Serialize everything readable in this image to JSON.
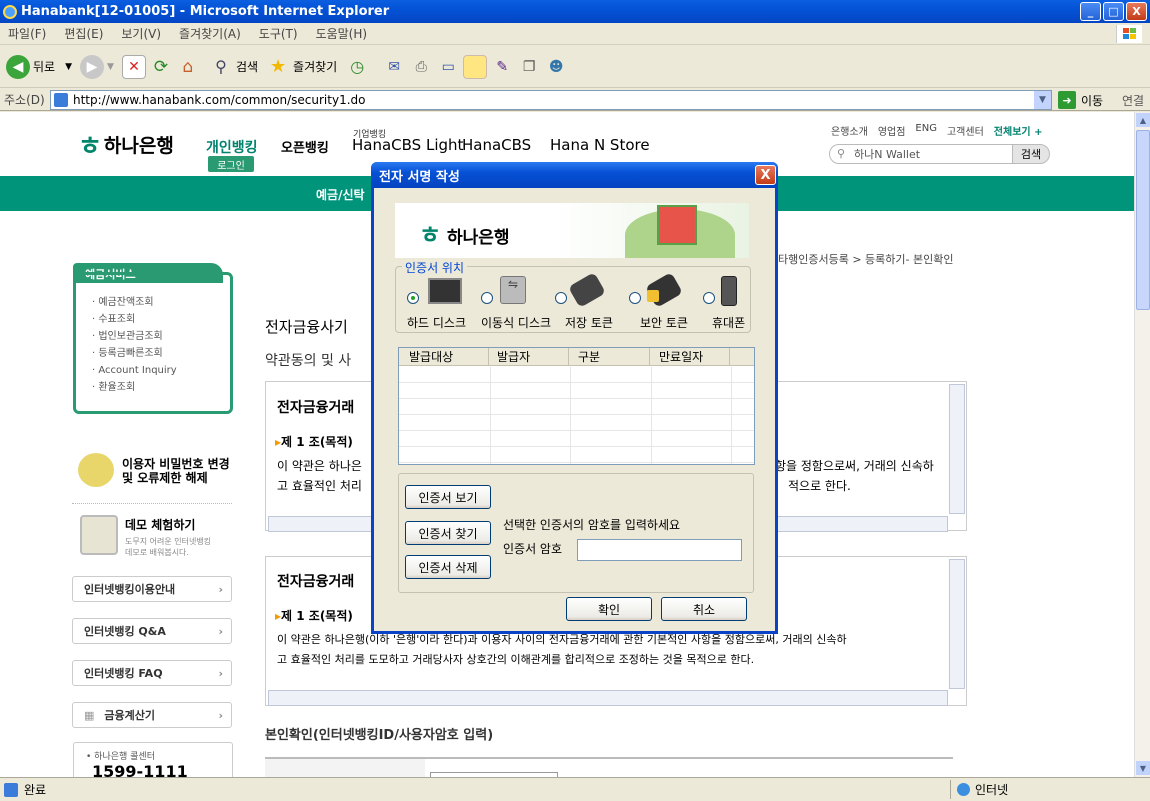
{
  "window": {
    "title": "Hanabank[12-01005] - Microsoft Internet Explorer",
    "min": "_",
    "max": "□",
    "close": "X"
  },
  "menu": [
    "파일(F)",
    "편집(E)",
    "보기(V)",
    "즐겨찾기(A)",
    "도구(T)",
    "도움말(H)"
  ],
  "toolbar": {
    "back": "뒤로",
    "search": "검색",
    "favorites": "즐겨찾기"
  },
  "address": {
    "label": "주소(D)",
    "url": "http://www.hanabank.com/common/security1.do",
    "go": "이동",
    "links": "연결"
  },
  "status": {
    "left": "완료",
    "zone": "인터넷"
  },
  "site": {
    "logo": "하나은행",
    "nav": {
      "personal": "개인뱅킹",
      "login": "로그인",
      "open": "오픈뱅킹",
      "corp_small": "기업뱅킹",
      "corp_light": "HanaCBS Light",
      "cbs": "HanaCBS",
      "store": "Hana N Store"
    },
    "util_links": [
      "은행소개",
      "영업점",
      "ENG",
      "고객센터",
      "전체보기 +"
    ],
    "search_placeholder": "하나N Wallet",
    "search_button": "검색",
    "greenbar_text": "예금/신탁",
    "breadcrumb": "타행인증서등록 > 등록하기- 본인확인",
    "side_title": "예금서비스",
    "side_items": [
      "예금잔액조회",
      "수표조회",
      "법인보관금조회",
      "등록금빠른조회",
      "Account Inquiry",
      "환율조회"
    ],
    "pw_title": "이용자 비밀번호 변경",
    "pw_title2": "및 오류제한 해제",
    "demo_title": "데모 체험하기",
    "demo_desc1": "도무지 어려운 인터넷뱅킹",
    "demo_desc2": "데모로 배워봅시다.",
    "side_links": [
      "인터넷뱅킹이용안내",
      "인터넷뱅킹 Q&A",
      "인터넷뱅킹 FAQ"
    ],
    "calc": "금융계산기",
    "callcenter_label": "• 하나은행 콜센터",
    "callcenter_number": "1599-1111",
    "heading1": "전자금융사기",
    "heading2": "약관동의 및 사",
    "term_title": "전자금융거래",
    "article1": "제 1 조(목적)",
    "term_text_right": "항을 정함으로써, 거래의 신속하",
    "term_text_right2": "적으로 한다.",
    "term_text_a": "이 약관은 하나은",
    "term_text_b": "고 효율적인 처리",
    "term2_line1": "이 약관은 하나은행(이하 '은행'이라 한다)과 이용자 사이의 전자금융거래에 관한 기본적인 사항을 정함으로써, 거래의 신속하",
    "term2_line2": "고 효율적인 처리를 도모하고 거래당사자 상호간의 이해관계를 합리적으로 조정하는 것을 목적으로 한다.",
    "identity_heading": "본인확인(인터넷뱅킹ID/사용자암호 입력)"
  },
  "dialog": {
    "title": "전자 서명 작성",
    "close": "X",
    "logo": "하나은행",
    "location_legend": "인증서 위치",
    "locations": [
      {
        "label": "하드 디스크",
        "selected": true,
        "icon": "monitor-icon"
      },
      {
        "label": "이동식 디스크",
        "selected": false,
        "icon": "usb-drive-icon"
      },
      {
        "label": "저장 토큰",
        "selected": false,
        "icon": "usb-token-icon"
      },
      {
        "label": "보안 토큰",
        "selected": false,
        "icon": "secure-token-icon"
      },
      {
        "label": "휴대폰",
        "selected": false,
        "icon": "phone-icon"
      }
    ],
    "columns": [
      "발급대상",
      "발급자",
      "구분",
      "만료일자"
    ],
    "view_button": "인증서   보기",
    "find_button": "인증서   찾기",
    "delete_button": "인증서 삭제",
    "prompt": "선택한 인증서의 암호를 입력하세요",
    "password_label": "인증서 암호",
    "password_value": "",
    "ok": "확인",
    "cancel": "취소"
  }
}
